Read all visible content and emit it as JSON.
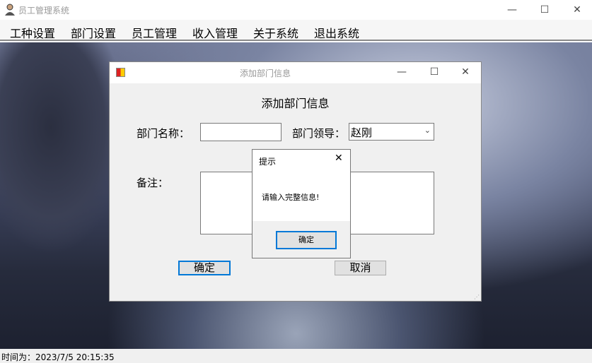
{
  "app": {
    "title": "员工管理系统",
    "minimize": "—",
    "maximize": "☐",
    "close": "✕"
  },
  "menu": [
    "工种设置",
    "部门设置",
    "员工管理",
    "收入管理",
    "关于系统",
    "退出系统"
  ],
  "status": "时间为：2023/7/5 20:15:35",
  "dialog": {
    "title": "添加部门信息",
    "heading": "添加部门信息",
    "name_label": "部门名称：",
    "name_value": "",
    "leader_label": "部门领导：",
    "leader_value": "赵刚",
    "note_label": "备注：",
    "note_value": "",
    "confirm": "确定",
    "cancel": "取消"
  },
  "msgbox": {
    "title": "提示",
    "close": "✕",
    "message": "请输入完整信息!",
    "ok": "确定"
  }
}
